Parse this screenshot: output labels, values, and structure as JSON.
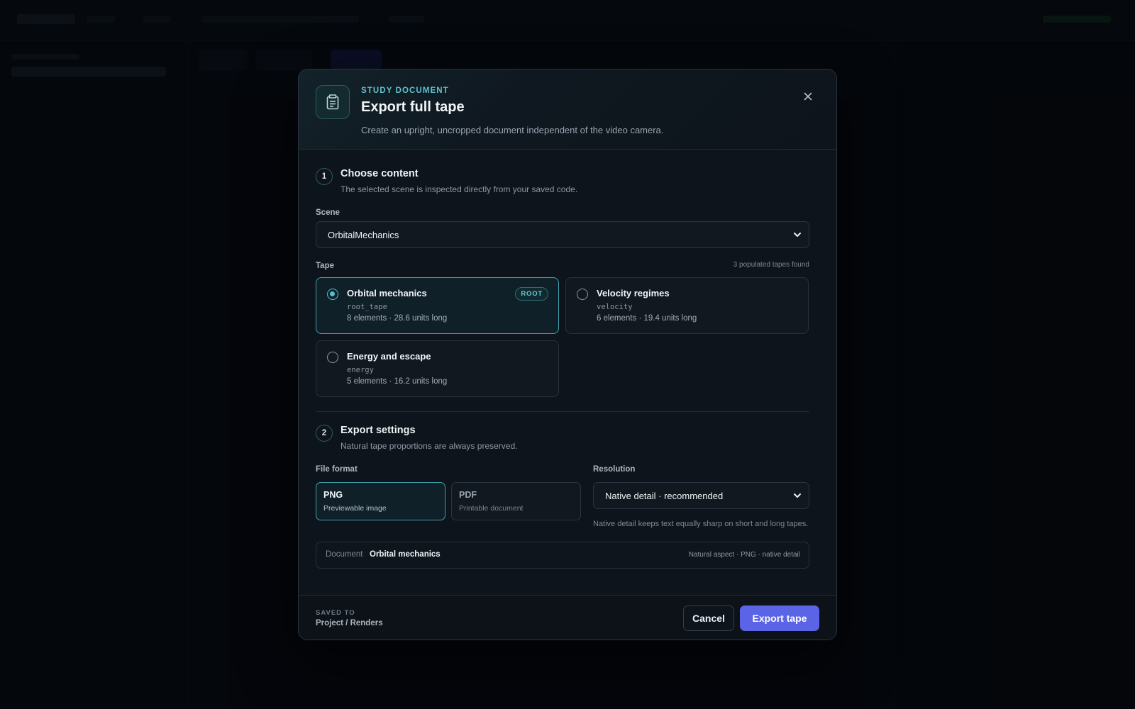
{
  "modal": {
    "eyebrow": "STUDY DOCUMENT",
    "title": "Export full tape",
    "subtitle": "Create an upright, uncropped document independent of the video camera.",
    "close_icon": "close-icon",
    "header_icon": "document-icon"
  },
  "step1": {
    "number": "1",
    "title": "Choose content",
    "description": "The selected scene is inspected directly from your saved code.",
    "scene_label": "Scene",
    "scene_value": "OrbitalMechanics",
    "tape_label": "Tape",
    "tapes_found": "3 populated tapes found",
    "tapes": [
      {
        "name": "Orbital mechanics",
        "id": "root_tape",
        "meta": "8 elements · 28.6 units long",
        "badge": "ROOT",
        "selected": true
      },
      {
        "name": "Velocity regimes",
        "id": "velocity",
        "meta": "6 elements · 19.4 units long",
        "selected": false
      },
      {
        "name": "Energy and escape",
        "id": "energy",
        "meta": "5 elements · 16.2 units long",
        "selected": false
      }
    ]
  },
  "step2": {
    "number": "2",
    "title": "Export settings",
    "description": "Natural tape proportions are always preserved.",
    "format_label": "File format",
    "formats": [
      {
        "name": "PNG",
        "desc": "Previewable image",
        "selected": true
      },
      {
        "name": "PDF",
        "desc": "Printable document",
        "selected": false
      }
    ],
    "resolution_label": "Resolution",
    "resolution_value": "Native detail · recommended",
    "resolution_hint": "Native detail keeps text equally sharp on short and long tapes."
  },
  "summary": {
    "label": "Document",
    "value": "Orbital mechanics",
    "meta": "Natural aspect · PNG · native detail"
  },
  "footer": {
    "saved_label": "SAVED TO",
    "saved_value": "Project / Renders",
    "cancel_label": "Cancel",
    "export_label": "Export tape"
  },
  "colors": {
    "accent": "#5b63e6",
    "teal": "#53c2cc",
    "background": "#05080c",
    "modal": "#0e141b"
  }
}
